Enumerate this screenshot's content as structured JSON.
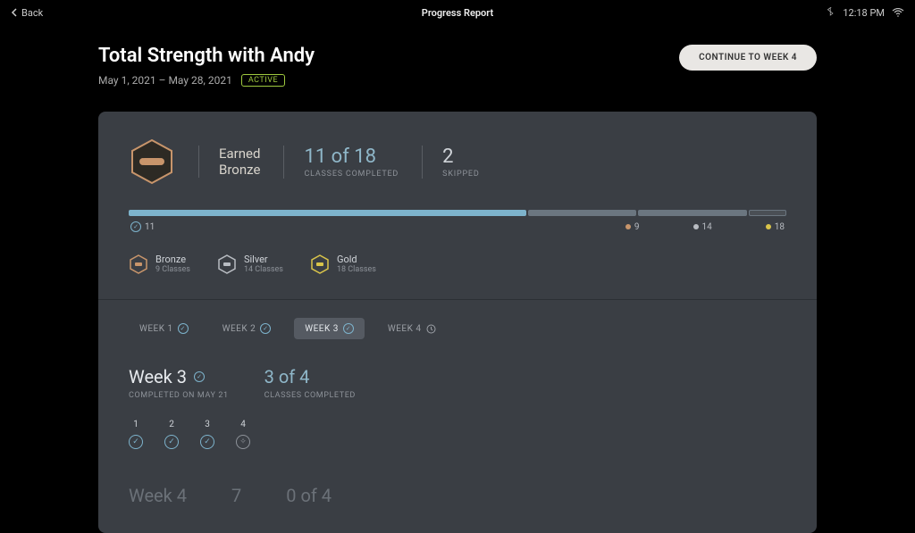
{
  "topbar": {
    "back": "Back",
    "title": "Progress Report",
    "time": "12:18 PM"
  },
  "header": {
    "program_title": "Total Strength with Andy",
    "date_range": "May 1, 2021 – May 28, 2021",
    "status": "ACTIVE",
    "cta": "CONTINUE TO WEEK 4"
  },
  "summary": {
    "badge_line1": "Earned",
    "badge_line2": "Bronze",
    "completed_value": "11 of 18",
    "completed_label": "CLASSES COMPLETED",
    "skipped_value": "2",
    "skipped_label": "SKIPPED"
  },
  "progress": {
    "current_marker": "11",
    "bronze_marker": "9",
    "silver_marker": "14",
    "gold_marker": "18"
  },
  "tiers": [
    {
      "name": "Bronze",
      "req": "9 Classes",
      "color": "#c8956b"
    },
    {
      "name": "Silver",
      "req": "14 Classes",
      "color": "#b8bcc2"
    },
    {
      "name": "Gold",
      "req": "18 Classes",
      "color": "#d9c44a"
    }
  ],
  "week_tabs": [
    {
      "label": "WEEK 1",
      "state": "done"
    },
    {
      "label": "WEEK 2",
      "state": "done"
    },
    {
      "label": "WEEK 3",
      "state": "selected"
    },
    {
      "label": "WEEK 4",
      "state": "locked"
    }
  ],
  "week_detail": {
    "title": "Week 3",
    "completed_on": "COMPLETED ON MAY 21",
    "classes_value": "3 of 4",
    "classes_label": "CLASSES COMPLETED",
    "dots": [
      {
        "n": "1",
        "done": true
      },
      {
        "n": "2",
        "done": true
      },
      {
        "n": "3",
        "done": true
      },
      {
        "n": "4",
        "done": false
      }
    ]
  },
  "week4_preview": {
    "title": "Week 4",
    "days": "7",
    "classes": "0 of 4"
  }
}
